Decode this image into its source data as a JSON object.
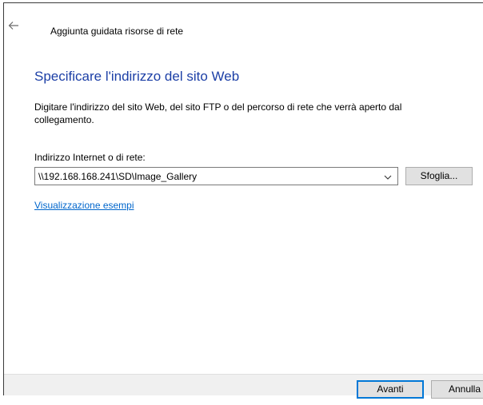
{
  "window": {
    "title": "Aggiunta guidata risorse di rete",
    "back_icon": "arrow-left-icon"
  },
  "page": {
    "heading": "Specificare l'indirizzo del sito Web",
    "description": "Digitare l'indirizzo del sito Web, del sito FTP o del percorso di rete che verrà aperto dal collegamento.",
    "field_label": "Indirizzo Internet o di rete:",
    "address_value": "\\\\192.168.168.241\\SD\\Image_Gallery",
    "dropdown_icon": "chevron-down-icon",
    "browse_label": "Sfoglia...",
    "examples_link": "Visualizzazione esempi"
  },
  "footer": {
    "next_label": "Avanti",
    "cancel_label": "Annulla"
  },
  "colors": {
    "heading": "#1c3fa6",
    "link": "#0066cc",
    "default_button_border": "#0078d7"
  }
}
